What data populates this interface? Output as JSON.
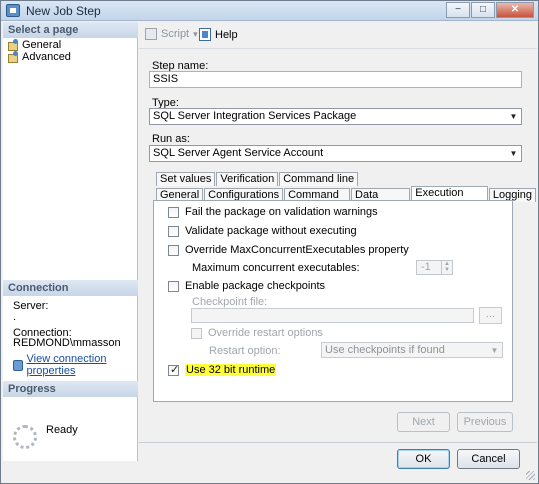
{
  "window": {
    "title": "New Job Step",
    "controls": [
      "−",
      "□",
      "✕"
    ]
  },
  "left": {
    "select_page_header": "Select a page",
    "pages": [
      "General",
      "Advanced"
    ],
    "connection_header": "Connection",
    "server_label": "Server:",
    "server_value": ".",
    "connection_label": "Connection:",
    "connection_value": "REDMOND\\mmasson",
    "view_connection_link": "View connection properties",
    "progress_header": "Progress",
    "progress_status": "Ready"
  },
  "toolbar": {
    "script_label": "Script",
    "script_dropdown": "▾",
    "help_label": "Help"
  },
  "form": {
    "step_name_label": "Step name:",
    "step_name_value": "SSIS",
    "type_label": "Type:",
    "type_value": "SQL Server Integration Services Package",
    "run_as_label": "Run as:",
    "run_as_value": "SQL Server Agent Service Account"
  },
  "tabs": {
    "back_row": [
      "Set values",
      "Verification",
      "Command line"
    ],
    "front_row": [
      "General",
      "Configurations",
      "Command files",
      "Data sources",
      "Execution options",
      "Logging"
    ],
    "active": "Execution options"
  },
  "options": {
    "fail_on_warnings": {
      "label": "Fail the package on validation warnings",
      "checked": false
    },
    "validate_only": {
      "label": "Validate package without executing",
      "checked": false
    },
    "override_max": {
      "label": "Override MaxConcurrentExecutables property",
      "checked": false
    },
    "max_concurrent_label": "Maximum concurrent executables:",
    "max_concurrent_value": "-1",
    "enable_checkpoints": {
      "label": "Enable package checkpoints",
      "checked": false
    },
    "checkpoint_file_label": "Checkpoint file:",
    "browse_label": "...",
    "override_restart": {
      "label": "Override restart options",
      "checked": false
    },
    "restart_option_label": "Restart option:",
    "restart_option_value": "Use checkpoints if found",
    "use_32bit": {
      "label": "Use 32 bit runtime",
      "checked": true
    }
  },
  "nav": {
    "next_label": "Next",
    "previous_label": "Previous"
  },
  "buttons": {
    "ok_label": "OK",
    "cancel_label": "Cancel"
  },
  "colors": {
    "highlight": "#ffff3a",
    "link": "#1a4fa0",
    "header_text": "#4a5a70"
  }
}
